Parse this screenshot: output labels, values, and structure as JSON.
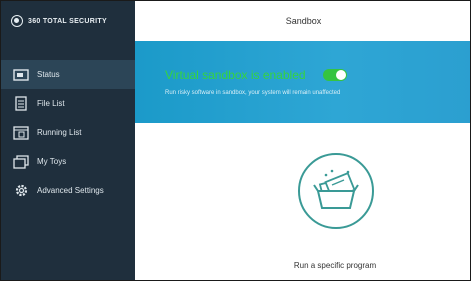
{
  "app": {
    "brand": "360 TOTAL SECURITY",
    "window_title": "Sandbox"
  },
  "sidebar": {
    "items": [
      {
        "label": "Status",
        "icon": "status-icon",
        "active": true
      },
      {
        "label": "File List",
        "icon": "file-list-icon",
        "active": false
      },
      {
        "label": "Running List",
        "icon": "running-list-icon",
        "active": false
      },
      {
        "label": "My Toys",
        "icon": "my-toys-icon",
        "active": false
      },
      {
        "label": "Advanced Settings",
        "icon": "gear-icon",
        "active": false
      }
    ]
  },
  "banner": {
    "status": "Virtual sandbox is enabled",
    "toggle_on": true,
    "description": "Run risky software in sandbox, your system will remain unaffected"
  },
  "main": {
    "run_label": "Run a specific program",
    "run_icon": "open-box-icon"
  },
  "colors": {
    "sidebar_bg": "#1f2f3d",
    "sidebar_active": "#2c4557",
    "banner_blue": "#1b9ac9",
    "status_green": "#35d43f",
    "toggle_green": "#35c441",
    "icon_teal": "#3a9a96"
  }
}
